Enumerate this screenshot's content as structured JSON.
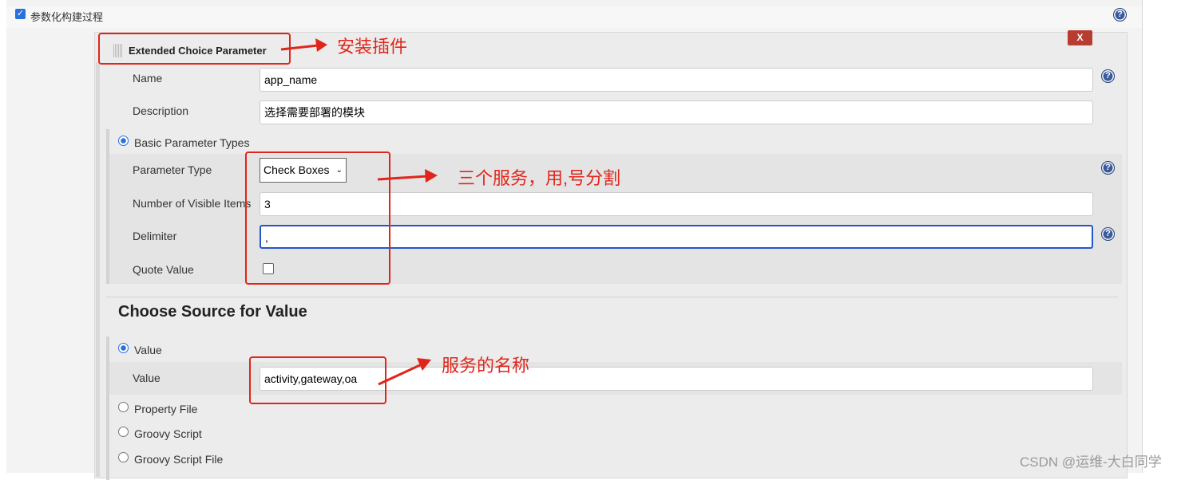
{
  "section": {
    "title": "参数化构建过程",
    "checked": true
  },
  "param": {
    "title": "Extended Choice Parameter",
    "delete_label": "X",
    "name_label": "Name",
    "name_value": "app_name",
    "desc_label": "Description",
    "desc_value": "选择需要部署的模块",
    "basic_label": "Basic Parameter Types",
    "ptype_label": "Parameter Type",
    "ptype_value": "Check Boxes",
    "visible_label": "Number of Visible Items",
    "visible_value": "3",
    "delim_label": "Delimiter",
    "delim_value": ",",
    "quote_label": "Quote Value",
    "quote_checked": false,
    "source_heading": "Choose Source for Value",
    "src_value_radio": "Value",
    "value_label": "Value",
    "value_value": "activity,gateway,oa",
    "src_property": "Property File",
    "src_groovy": "Groovy Script",
    "src_groovy_file": "Groovy Script File"
  },
  "annotations": {
    "a1": "安装插件",
    "a2": "三个服务，用,号分割",
    "a3": "服务的名称",
    "color": "#e0261b"
  },
  "watermark": "CSDN @运维-大白同学"
}
